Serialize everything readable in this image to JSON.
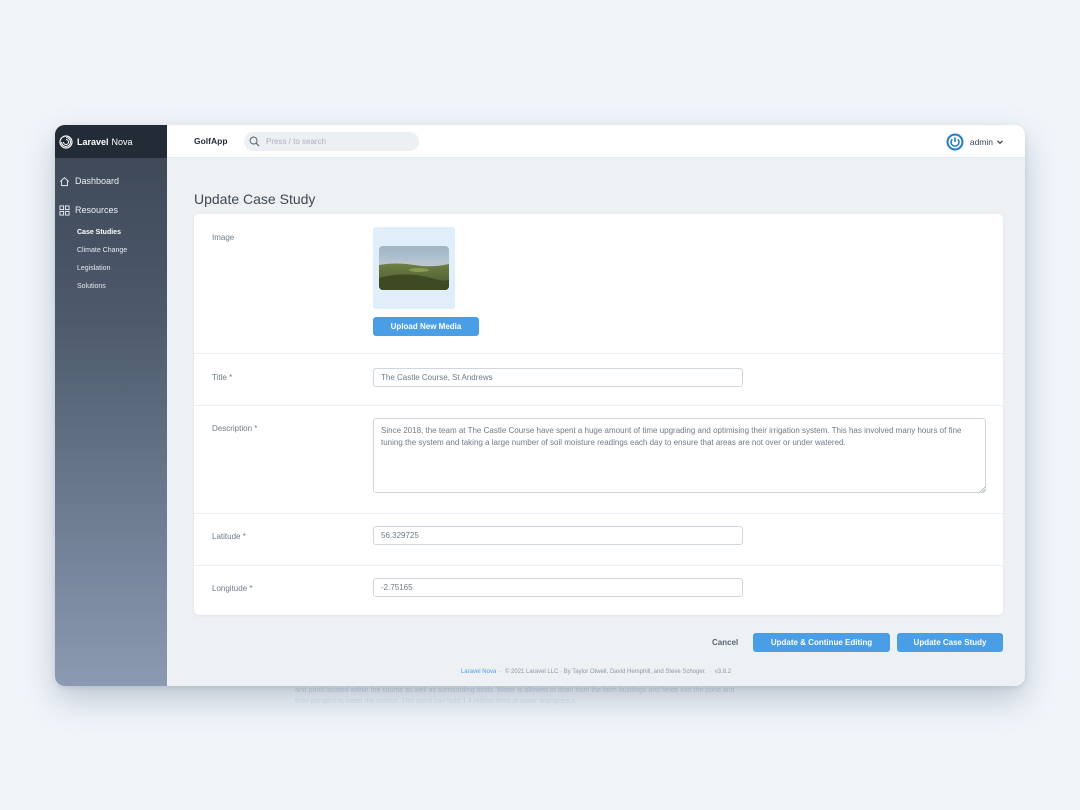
{
  "brand": {
    "name_bold": "Laravel",
    "name_rest": "Nova"
  },
  "sidebar": {
    "dashboard_label": "Dashboard",
    "resources_label": "Resources",
    "items": [
      {
        "label": "Case Studies",
        "active": true
      },
      {
        "label": "Climate Change",
        "active": false
      },
      {
        "label": "Legislation",
        "active": false
      },
      {
        "label": "Solutions",
        "active": false
      }
    ]
  },
  "header": {
    "app_name": "GolfApp",
    "search_placeholder": "Press / to search",
    "user_name": "admin"
  },
  "page": {
    "title": "Update Case Study"
  },
  "form": {
    "image_label": "Image",
    "upload_button": "Upload New Media",
    "title_label": "Title *",
    "title_value": "The Castle Course, St Andrews",
    "description_label": "Description *",
    "description_value": "Since 2018, the team at The Castle Course have spent a huge amount of time upgrading and optimising their irrigation system. This has involved many hours of fine tuning the system and taking a large number of soil moisture readings each day to ensure that areas are not over or under watered.",
    "latitude_label": "Latitude *",
    "latitude_value": "56.329725",
    "longitude_label": "Longitude *",
    "longitude_value": "-2.75165"
  },
  "actions": {
    "cancel": "Cancel",
    "update_continue": "Update & Continue Editing",
    "update": "Update Case Study"
  },
  "footer": {
    "link": "Laravel Nova",
    "credits": "© 2021 Laravel LLC · By Taylor Otwell, David Hemphill, and Steve Schoger.",
    "version": "v3.8.2"
  },
  "background_text": {
    "line1": "and pond located within the course as well as surrounding fields. Water is allowed to drain from the farm buildings and fields into the pond and",
    "line2": "then pumped to water the course. This pond can hold 1.4 Million litres of water and gives a..."
  },
  "colors": {
    "accent": "#4a9ee6",
    "sidebar_top": "#3c4655",
    "sidebar_bottom": "#8b9ab0",
    "page_bg": "#f1f5fa"
  },
  "icons": {
    "brand": "laravel-nova-swirl-icon",
    "dashboard": "home-icon",
    "resources": "grid-icon",
    "search": "search-icon",
    "avatar": "power-icon",
    "user_menu": "chevron-down-icon"
  }
}
